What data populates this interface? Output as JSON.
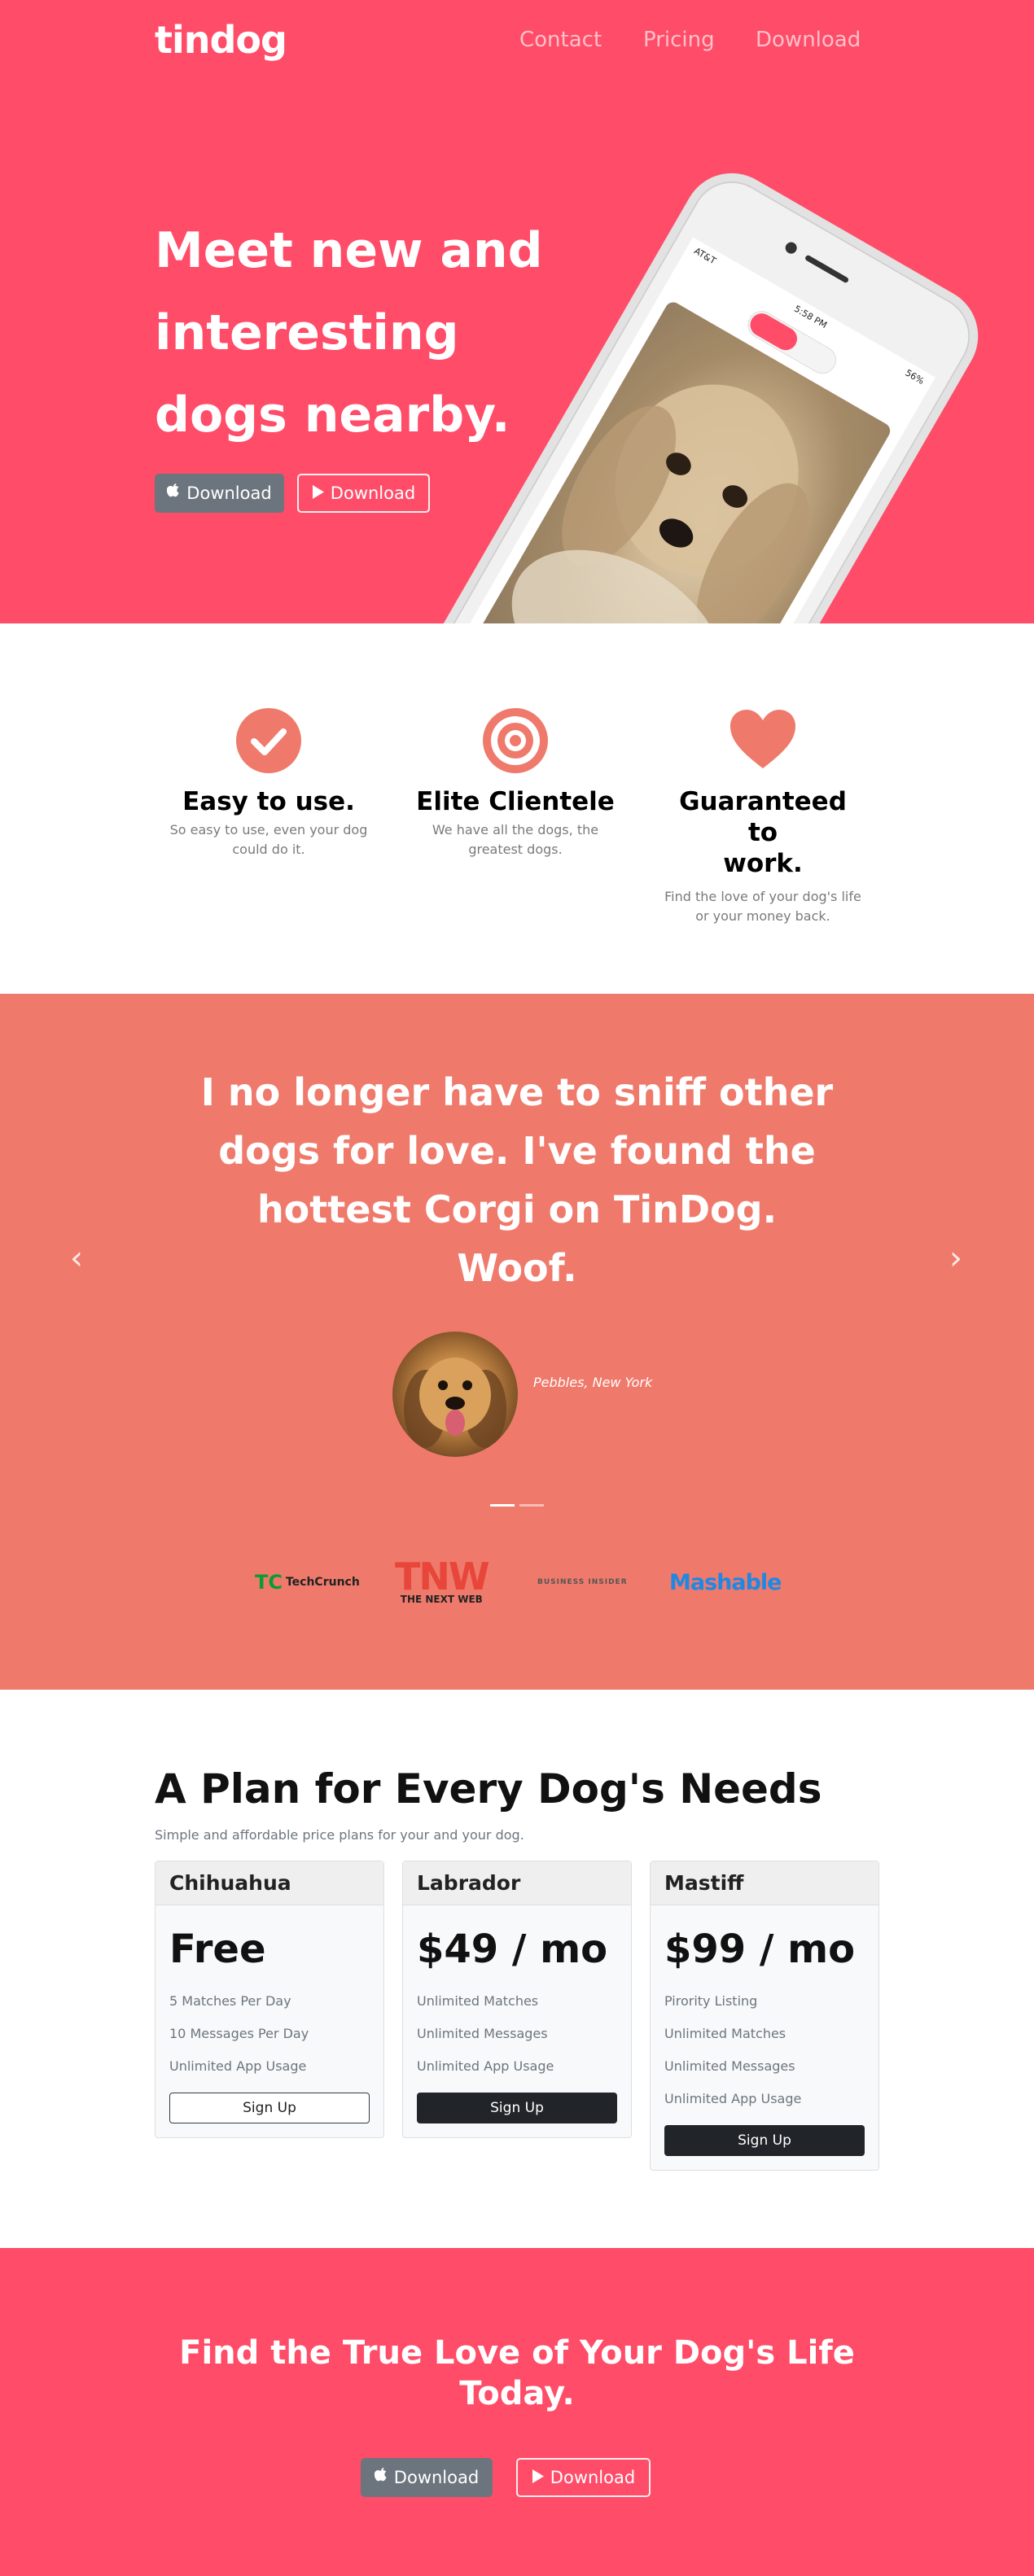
{
  "nav": {
    "brand": "tindog",
    "links": [
      "Contact",
      "Pricing",
      "Download"
    ]
  },
  "hero": {
    "title_lines": [
      "Meet new and",
      "interesting",
      "dogs nearby."
    ],
    "btn_apple": "Download",
    "btn_play": "Download",
    "phone_status": {
      "carrier": "AT&T",
      "time": "5:58 PM",
      "battery": "56%"
    }
  },
  "features": [
    {
      "icon": "check-circle-icon",
      "title": "Easy to use.",
      "text_lines": [
        "So easy to use, even your dog",
        "could do it."
      ]
    },
    {
      "icon": "bullseye-icon",
      "title": "Elite Clientele",
      "text_lines": [
        "We have all the dogs, the",
        "greatest dogs."
      ]
    },
    {
      "icon": "heart-icon",
      "title_lines": [
        "Guaranteed to",
        "work."
      ],
      "text_lines": [
        "Find the love of your dog's life",
        "or your money back."
      ]
    }
  ],
  "testimonial": {
    "quote_lines": [
      "I no longer have to sniff other",
      "dogs for love. I've found the",
      "hottest Corgi on TinDog.",
      "Woof."
    ],
    "author": "Pebbles, New York",
    "prev_glyph": "‹",
    "next_glyph": "›"
  },
  "press": {
    "techcrunch": "TechCrunch",
    "tc_mark": "TC",
    "tnw": "TNW",
    "tnw_sub": "THE NEXT WEB",
    "business_insider": "BUSINESS INSIDER",
    "mashable": "Mashable"
  },
  "pricing": {
    "title": "A Plan for Every Dog's Needs",
    "subtitle": "Simple and affordable price plans for your and your dog.",
    "plans": [
      {
        "name": "Chihuahua",
        "price": "Free",
        "features": [
          "5 Matches Per Day",
          "10 Messages Per Day",
          "Unlimited App Usage"
        ],
        "button": "Sign Up"
      },
      {
        "name": "Labrador",
        "price": "$49 / mo",
        "features": [
          "Unlimited Matches",
          "Unlimited Messages",
          "Unlimited App Usage"
        ],
        "button": "Sign Up"
      },
      {
        "name": "Mastiff",
        "price": "$99 / mo",
        "features": [
          "Pirority Listing",
          "Unlimited Matches",
          "Unlimited Messages",
          "Unlimited App Usage"
        ],
        "button": "Sign Up"
      }
    ]
  },
  "cta": {
    "title_lines": [
      "Find the True Love of Your Dog's Life",
      "Today."
    ],
    "btn_apple": "Download",
    "btn_play": "Download"
  },
  "colors": {
    "hero_bg": "#ff4c68",
    "testimonial_bg": "#ef7a6b",
    "feature_icon": "#ef7a6b"
  }
}
